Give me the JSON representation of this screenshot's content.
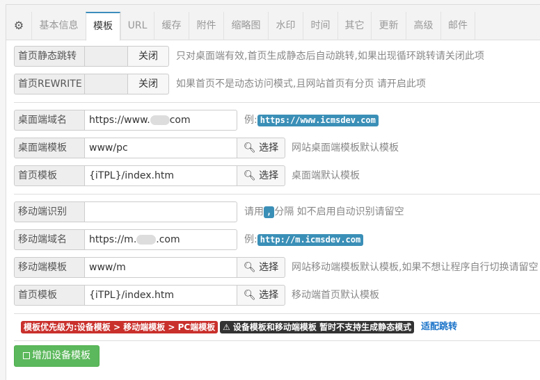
{
  "tabs": [
    {
      "label": "⚙",
      "name": "tab-settings-gear"
    },
    {
      "label": "基本信息",
      "name": "tab-basic-info"
    },
    {
      "label": "模板",
      "name": "tab-template"
    },
    {
      "label": "URL",
      "name": "tab-url"
    },
    {
      "label": "缓存",
      "name": "tab-cache"
    },
    {
      "label": "附件",
      "name": "tab-attachment"
    },
    {
      "label": "缩略图",
      "name": "tab-thumbnail"
    },
    {
      "label": "水印",
      "name": "tab-watermark"
    },
    {
      "label": "时间",
      "name": "tab-time"
    },
    {
      "label": "其它",
      "name": "tab-other"
    },
    {
      "label": "更新",
      "name": "tab-update"
    },
    {
      "label": "高级",
      "name": "tab-advanced"
    },
    {
      "label": "邮件",
      "name": "tab-mail"
    }
  ],
  "active_tab": "模板",
  "static_jump": {
    "label": "首页静态跳转",
    "toggle": "关闭",
    "help": "只对桌面端有效,首页生成静态后自动跳转,如果出现循环跳转请关闭此项"
  },
  "rewrite": {
    "label": "首页REWRITE",
    "toggle": "关闭",
    "help": "如果首页不是动态访问模式,且网站首页有分页 请开启此项"
  },
  "desktop_domain": {
    "label": "桌面端域名",
    "value_prefix": "https://www.",
    "value_suffix": "com",
    "help_prefix": "例:",
    "example": "https://www.icmsdev.com"
  },
  "desktop_tpl": {
    "label": "桌面端模板",
    "value": "www/pc",
    "button": "选择",
    "help": "网站桌面端模板默认模板"
  },
  "desktop_index": {
    "label": "首页模板",
    "value": "{iTPL}/index.htm",
    "button": "选择",
    "help": "桌面端默认模板"
  },
  "mobile_detect": {
    "label": "移动端识别",
    "value": "",
    "help_prefix": "请用",
    "sep": ",",
    "help_suffix": "分隔 如不启用自动识别请留空"
  },
  "mobile_domain": {
    "label": "移动端域名",
    "value_prefix": "https://m.",
    "value_suffix": ".com",
    "help_prefix": "例:",
    "example": "http://m.icmsdev.com"
  },
  "mobile_tpl": {
    "label": "移动端模板",
    "value": "www/m",
    "button": "选择",
    "help": "网站移动端模板默认模板,如果不想让程序自行切换请留空"
  },
  "mobile_index": {
    "label": "首页模板",
    "value": "{iTPL}/index.htm",
    "button": "选择",
    "help": "移动端首页默认模板"
  },
  "notes": {
    "priority": "模板优先级为:设备模板 > 移动端模板 > PC端模板",
    "warning": "⚠ 设备模板和移动端模板 暂时不支持生成静态模式",
    "link": "适配跳转"
  },
  "add_button": "增加设备模板",
  "colors": {
    "primary": "#3c8dbc",
    "code_bg": "#3a8fb7",
    "danger": "#c9302c",
    "dark": "#333333",
    "success": "#5cb85c"
  }
}
